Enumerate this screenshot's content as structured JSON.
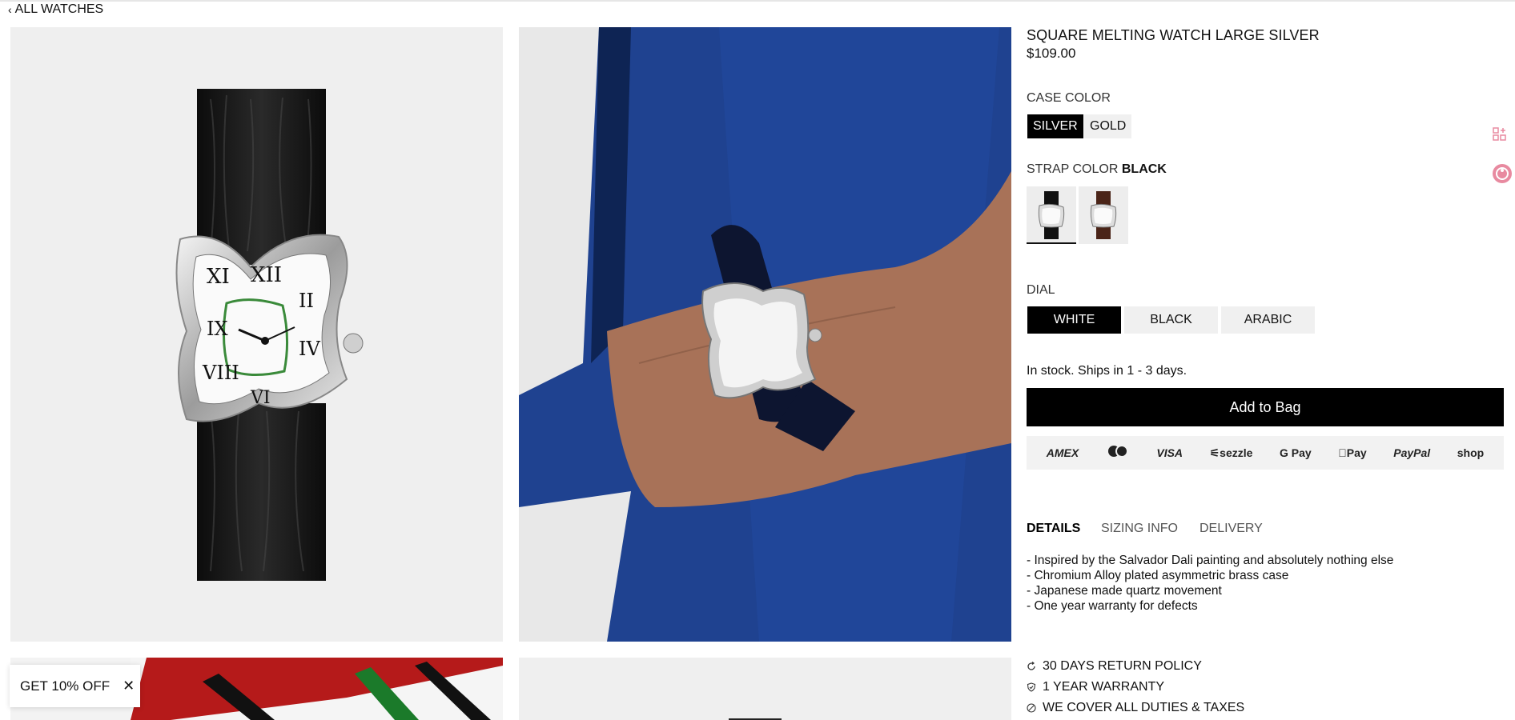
{
  "nav": {
    "back_label": "ALL WATCHES",
    "back_icon": "chevron-left-icon"
  },
  "product": {
    "title": "SQUARE MELTING WATCH LARGE SILVER",
    "price": "$109.00"
  },
  "case_color": {
    "label": "CASE COLOR",
    "options": [
      {
        "label": "SILVER",
        "selected": true
      },
      {
        "label": "GOLD",
        "selected": false
      }
    ]
  },
  "strap_color": {
    "label": "STRAP COLOR",
    "selected_value": "BLACK",
    "swatches": [
      {
        "name": "black",
        "color": "#111111",
        "selected": true
      },
      {
        "name": "brown",
        "color": "#4a2418",
        "selected": false
      }
    ]
  },
  "dial": {
    "label": "DIAL",
    "options": [
      {
        "label": "WHITE",
        "selected": true
      },
      {
        "label": "BLACK",
        "selected": false
      },
      {
        "label": "ARABIC",
        "selected": false
      }
    ]
  },
  "stock_text": "In stock. Ships in 1 - 3 days.",
  "add_to_bag_label": "Add to Bag",
  "payments": [
    "AMEX",
    "mastercard",
    "VISA",
    "sezzle",
    "G Pay",
    "Pay",
    "PayPal",
    "shop"
  ],
  "tabs": [
    {
      "label": "DETAILS",
      "active": true
    },
    {
      "label": "SIZING INFO",
      "active": false
    },
    {
      "label": "DELIVERY",
      "active": false
    }
  ],
  "details": [
    "Inspired by the Salvador Dali painting and absolutely nothing else",
    "Chromium Alloy plated asymmetric brass case",
    "Japanese made quartz movement",
    "One year warranty for defects"
  ],
  "policies": [
    {
      "icon": "refresh-icon",
      "label": "30 DAYS RETURN POLICY"
    },
    {
      "icon": "shield-check-icon",
      "label": "1 YEAR WARRANTY"
    },
    {
      "icon": "no-fee-icon",
      "label": "WE COVER ALL DUTIES & TAXES"
    }
  ],
  "promo": {
    "label": "GET 10% OFF",
    "close_icon": "close-icon"
  },
  "colors": {
    "accent": "#000000",
    "chip_bg": "#f0f0f0",
    "floating_icon": "#e88aa0"
  }
}
